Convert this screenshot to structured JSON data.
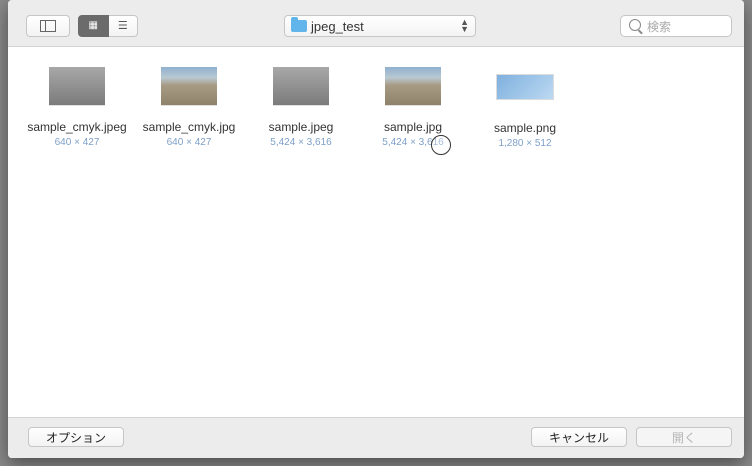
{
  "toolbar": {
    "path_label": "jpeg_test",
    "search_placeholder": "検索"
  },
  "files": [
    {
      "name": "sample_cmyk.jpeg",
      "dims": "640 × 427"
    },
    {
      "name": "sample_cmyk.jpg",
      "dims": "640 × 427"
    },
    {
      "name": "sample.jpeg",
      "dims": "5,424 × 3,616"
    },
    {
      "name": "sample.jpg",
      "dims": "5,424 × 3,616"
    },
    {
      "name": "sample.png",
      "dims": "1,280 × 512"
    }
  ],
  "footer": {
    "options_label": "オプション",
    "cancel_label": "キャンセル",
    "open_label": "開く"
  }
}
